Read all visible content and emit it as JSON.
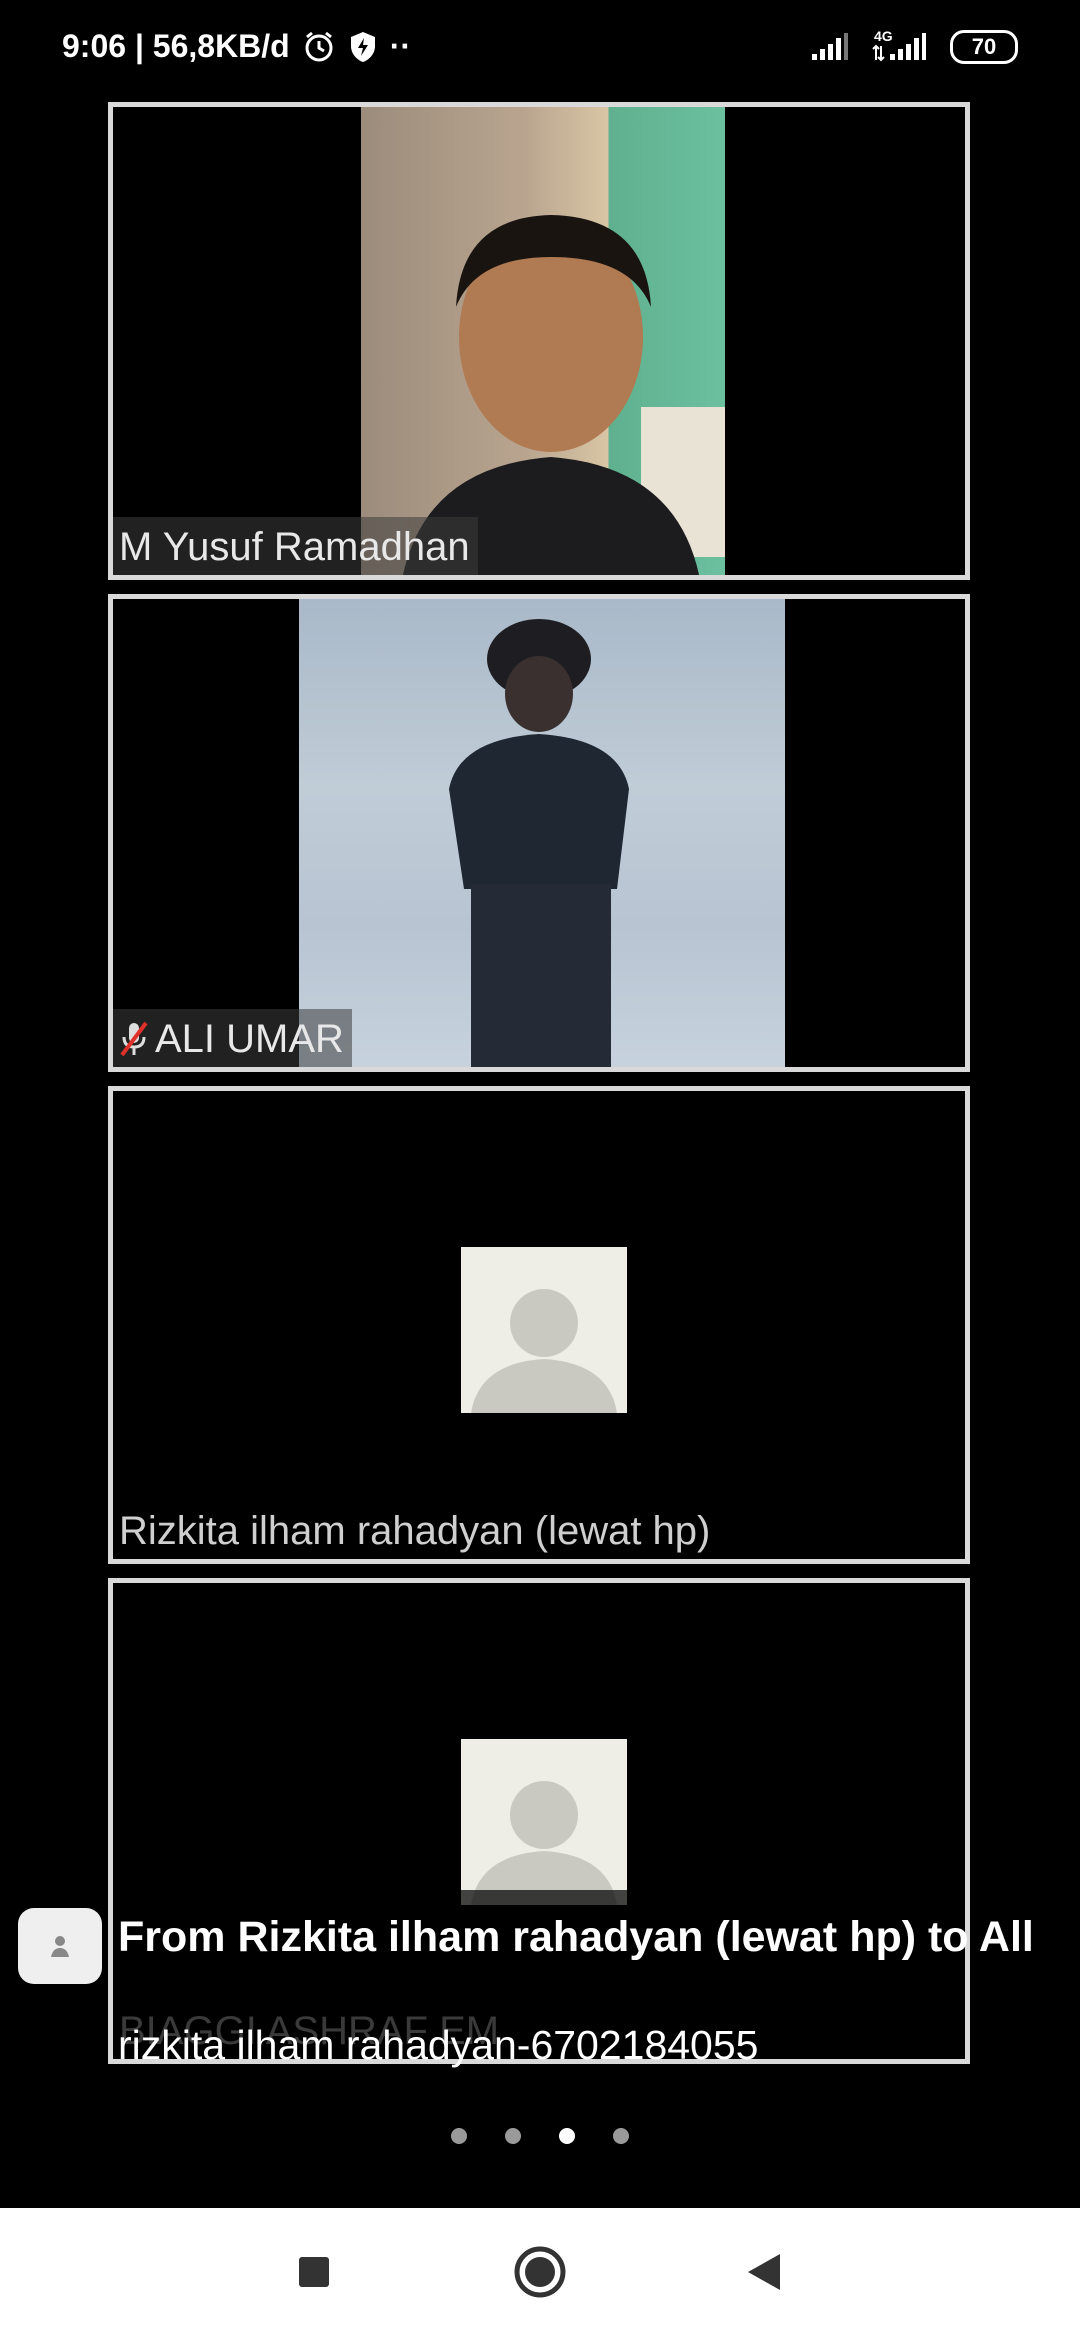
{
  "status_bar": {
    "time_speed": "9:06 | 56,8KB/d",
    "dots": "··",
    "network_type": "4G",
    "battery": "70"
  },
  "participants": [
    {
      "name": "M Yusuf Ramadhan",
      "video": true,
      "muted": false
    },
    {
      "name": "ALI UMAR",
      "video": true,
      "muted": true
    },
    {
      "name": "Rizkita ilham rahadyan (lewat hp)",
      "video": false,
      "muted": false
    },
    {
      "name": "BIAGGI ASHRAF EM",
      "video": false,
      "muted": false
    }
  ],
  "chat_toast": {
    "title": "From Rizkita ilham rahadyan (lewat hp) to All",
    "message": "rizkita ilham rahadyan-6702184055"
  },
  "pager": {
    "count": 4,
    "active_index": 2
  },
  "icons": {
    "alarm": "alarm-icon",
    "shield": "shield-bolt-icon",
    "signal": "signal-icon",
    "mic_off": "mic-off-icon",
    "recent": "recent-apps-icon",
    "home": "home-icon",
    "back": "back-icon"
  }
}
